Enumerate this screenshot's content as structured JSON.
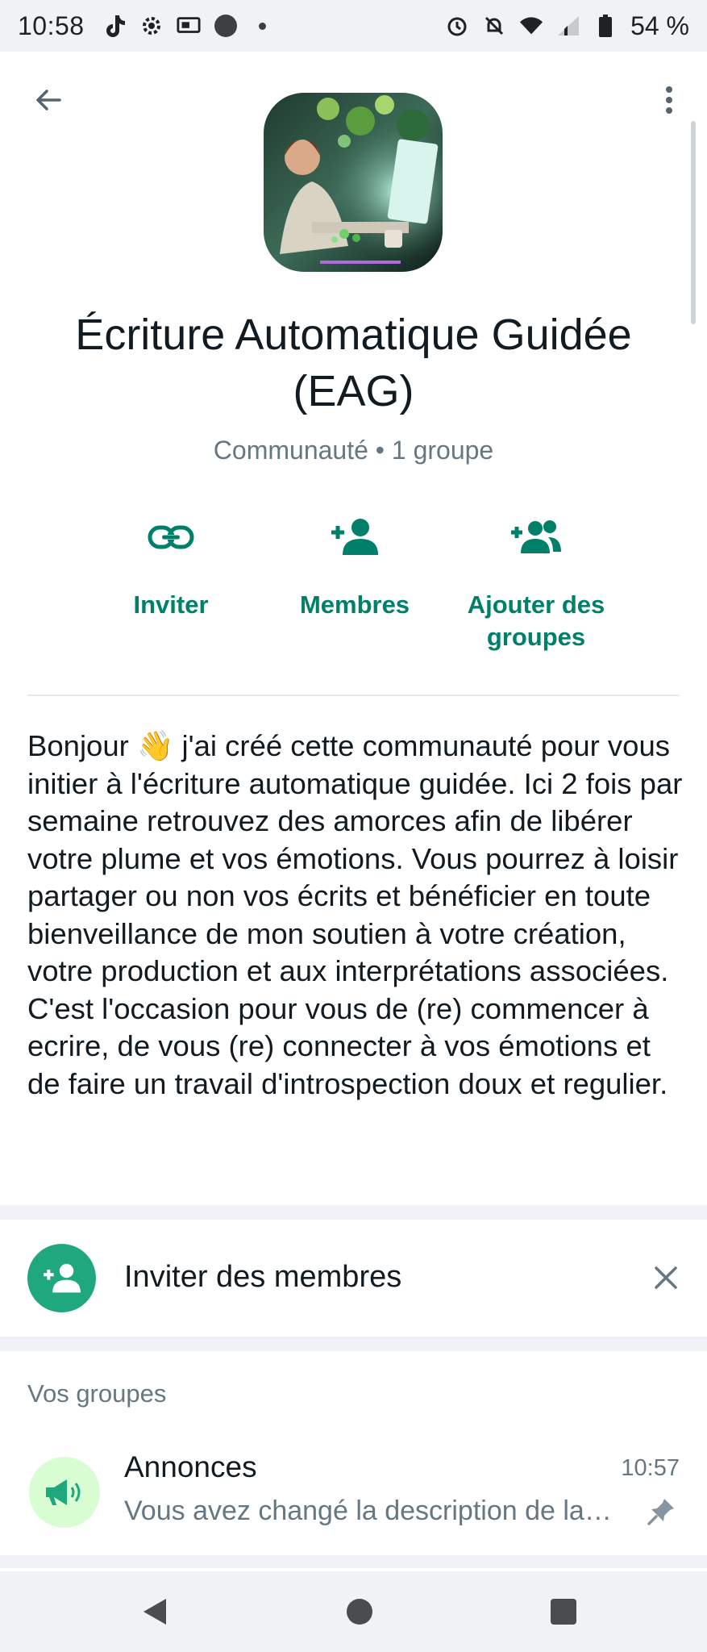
{
  "status_bar": {
    "time": "10:58",
    "battery": "54 %",
    "left_icons": [
      "tiktok-icon",
      "settings-icon",
      "cast-icon",
      "circle-icon",
      "dot-icon"
    ],
    "right_icons": [
      "alarm-icon",
      "bell-off-icon",
      "wifi-icon",
      "signal-icon",
      "battery-icon"
    ]
  },
  "header": {
    "back_icon": "arrow-left-icon",
    "more_icon": "more-vertical-icon"
  },
  "community": {
    "name": "Écriture Automatique Guidée (EAG)",
    "subtitle": "Communauté • 1 groupe"
  },
  "actions": [
    {
      "label": "Inviter",
      "icon": "link-icon"
    },
    {
      "label": "Membres",
      "icon": "person-add-icon"
    },
    {
      "label": "Ajouter des groupes",
      "icon": "group-add-icon"
    }
  ],
  "description": "Bonjour 👋 j'ai créé cette communauté pour vous initier à l'écriture automatique guidée. Ici 2 fois par semaine retrouvez des amorces afin de libérer votre plume et vos émotions. Vous pourrez à loisir partager ou non vos écrits et bénéficier en toute bienveillance de mon soutien à votre création, votre production et aux interprétations associées.\nC'est l'occasion pour vous de (re) commencer à ecrire, de vous (re) connecter à vos émotions et de faire un travail d'introspection doux et regulier.",
  "invite_banner": {
    "label": "Inviter des membres",
    "icon": "person-add-icon",
    "close_icon": "close-icon"
  },
  "groups_section": {
    "title": "Vos groupes",
    "items": [
      {
        "name": "Annonces",
        "time": "10:57",
        "last_message": "Vous avez changé la description de la communauté",
        "icon": "megaphone-icon",
        "pinned": true
      }
    ]
  },
  "nav_bar": {
    "icons": [
      "nav-back-icon",
      "nav-home-icon",
      "nav-recents-icon"
    ]
  },
  "colors": {
    "accent": "#008069",
    "accent_circle": "#1fa77d",
    "secondary_text": "#667781",
    "primary_text": "#111b21",
    "background_gray": "#f0f2f5"
  }
}
